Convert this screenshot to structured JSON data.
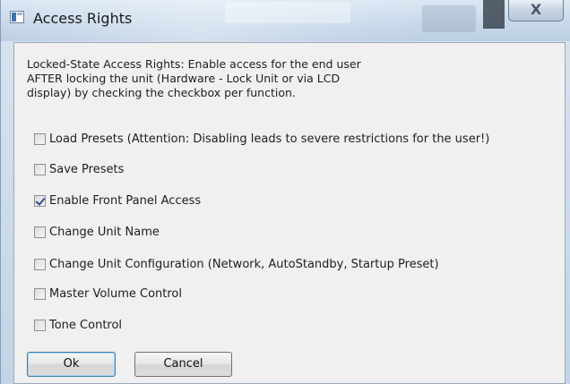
{
  "window": {
    "title": "Access Rights",
    "close_label": "X"
  },
  "dialog": {
    "description": "Locked-State Access Rights: Enable access for the end user\nAFTER locking the unit (Hardware - Lock Unit or via LCD\ndisplay) by checking the checkbox per function.",
    "options": [
      {
        "label": "Load Presets (Attention: Disabling leads to severe restrictions for the user!)",
        "checked": false
      },
      {
        "label": "Save Presets",
        "checked": false
      },
      {
        "label": "Enable Front Panel Access",
        "checked": true
      },
      {
        "label": "Change Unit Name",
        "checked": false
      },
      {
        "label": "Change Unit Configuration (Network, AutoStandby, Startup Preset)",
        "checked": false
      },
      {
        "label": "Master Volume Control",
        "checked": false
      },
      {
        "label": "Tone Control",
        "checked": false
      }
    ],
    "ok_label": "Ok",
    "cancel_label": "Cancel"
  },
  "icons": {
    "app": "application-window-icon",
    "close": "close-icon",
    "check": "checkmark-icon"
  },
  "colors": {
    "titlebar": "#c7d8ea",
    "client_bg": "#f0f0f0",
    "checkmark": "#2a4c8f",
    "default_button_border": "#3c7fb1"
  }
}
